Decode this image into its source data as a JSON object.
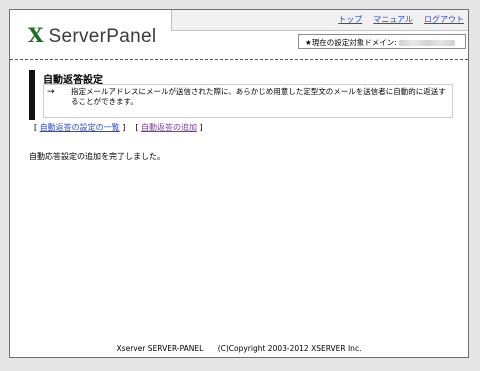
{
  "header": {
    "logo_mark": "X",
    "logo_text": "ServerPanel",
    "nav": [
      "トップ",
      "マニュアル",
      "ログアウト"
    ],
    "domain_label": "★現在の設定対象ドメイン:"
  },
  "section": {
    "title": "自動返答設定",
    "arrow": "→",
    "description": "指定メールアドレスにメールが送信された際に、あらかじめ用意した定型文のメールを送信者に自動的に返送することができます。"
  },
  "links": {
    "list_label": "自動返答の設定の一覧",
    "add_label": "自動返答の追加"
  },
  "message": "自動応答設定の追加を完了しました。",
  "footer": {
    "product": "Xserver SERVER-PANEL",
    "copyright": "(C)Copyright 2003-2012 XSERVER Inc."
  }
}
